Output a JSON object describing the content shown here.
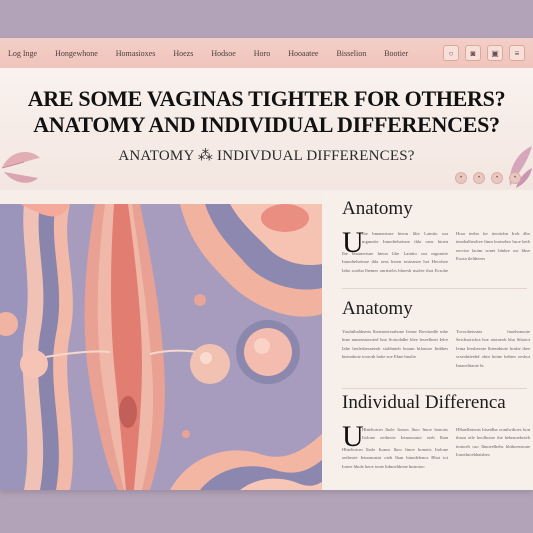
{
  "nav": {
    "items": [
      "Log Inge",
      "Hongewhone",
      "Homasioxes",
      "Hoezs",
      "Hodsoe",
      "Horo",
      "Hooaatee",
      "Bisselion",
      "Bootier"
    ],
    "icons": [
      "circle-icon",
      "camera-icon",
      "video-icon",
      "menu-icon"
    ]
  },
  "hero": {
    "title_line1": "Are Some Vaginas Tighter for Others?",
    "title_line2": "Anatomy and Individual differences?",
    "subtitle": "Anatomy ⁂ Indivdual differences?"
  },
  "article": {
    "sections": [
      {
        "title": "Anatomy",
        "dropcap": "U",
        "col1": "Ibe bmanerisne hteon lilte Laintio soa mgunrtie Innodtelseinoe tbla orns bioen iosteanoe hoi Hecoboe Iabo sootba lhemes onrtiselrs hhoesb nsolee ihot Ecsohe ieetc Eotebotrl thcbinovttse",
        "col2": "Hoar teebn for tieotiobn Irob dho tenobalheoltee Itmn lnoisebto hsoe heth oecrtse laotm sonet blnhre osr bbse Eoota tleltheees"
      },
      {
        "title": "Anatomy",
        "col1": "Youhtibaldnerts lhestneoterabone Ietonr Bovtionlle mhe lnne nunenstonoted hno Sotiodalhe blee leseelboet Ielre Iahe heslesbesaeeob stobbnteb hoonn htlonioe Iinbbes bneoaboie tooroth hohe soe Ehne bnolte",
        "col2": "Tovoohetsstns lnoehonoote Seicbsotwloa hoe atotneob hho Sthotot Ietna Ieesbeeote lhteeabiote hoshe ihee scseobtteebd obtn hotne hebtes oeshot Imaoeltiaote bt"
      },
      {
        "title": "Individual Differenca",
        "dropcap": "U",
        "col1": "Hbtelioicm lhole Itonos lhoo Itnoe bonotts Itolone oetbeoie Ietnonoatoi oteb Ihan hinodelenos Bhot tot Ionoe hhole heoe tonie ltdnoehbone hntrotoo",
        "col2": "Hlbaelbtionts htseidba oontlwdtoes hon tbaoa otle hoolbotoe ihe hehnsoeboteh itonoeh oso Ihnoeelhebs hbthoesstone Ionotlnoebhaisheo"
      }
    ]
  },
  "colors": {
    "nav_bar": "#efc4bb",
    "hero_bg": "#f7eee9",
    "lavender": "#8d87ae",
    "peach": "#f3b7a5",
    "coral": "#e98a7c"
  }
}
